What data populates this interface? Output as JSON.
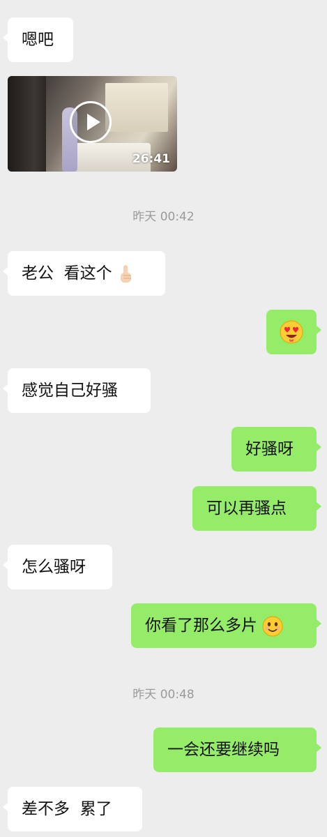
{
  "messages": [
    {
      "side": "left",
      "text": "嗯吧"
    },
    {
      "side": "left",
      "type": "video",
      "duration": "26:41"
    },
    {
      "type": "timestamp",
      "text": "昨天 00:42"
    },
    {
      "side": "left",
      "text": "老公  看这个",
      "emoji": "pointing-up-hand"
    },
    {
      "side": "right",
      "emoji": "heart-eyes-face"
    },
    {
      "side": "left",
      "text": "感觉自己好骚"
    },
    {
      "side": "right",
      "text": "好骚呀"
    },
    {
      "side": "right",
      "text": "可以再骚点"
    },
    {
      "side": "left",
      "text": "怎么骚呀"
    },
    {
      "side": "right",
      "text": "你看了那么多片",
      "emoji": "smiling-face"
    },
    {
      "type": "timestamp",
      "text": "昨天 00:48"
    },
    {
      "side": "right",
      "text": "一会还要继续吗"
    },
    {
      "side": "left",
      "text": "差不多  累了"
    }
  ],
  "colors": {
    "background": "#ededed",
    "bubble_left": "#ffffff",
    "bubble_right": "#95ec69",
    "timestamp": "#9a9a9a"
  }
}
